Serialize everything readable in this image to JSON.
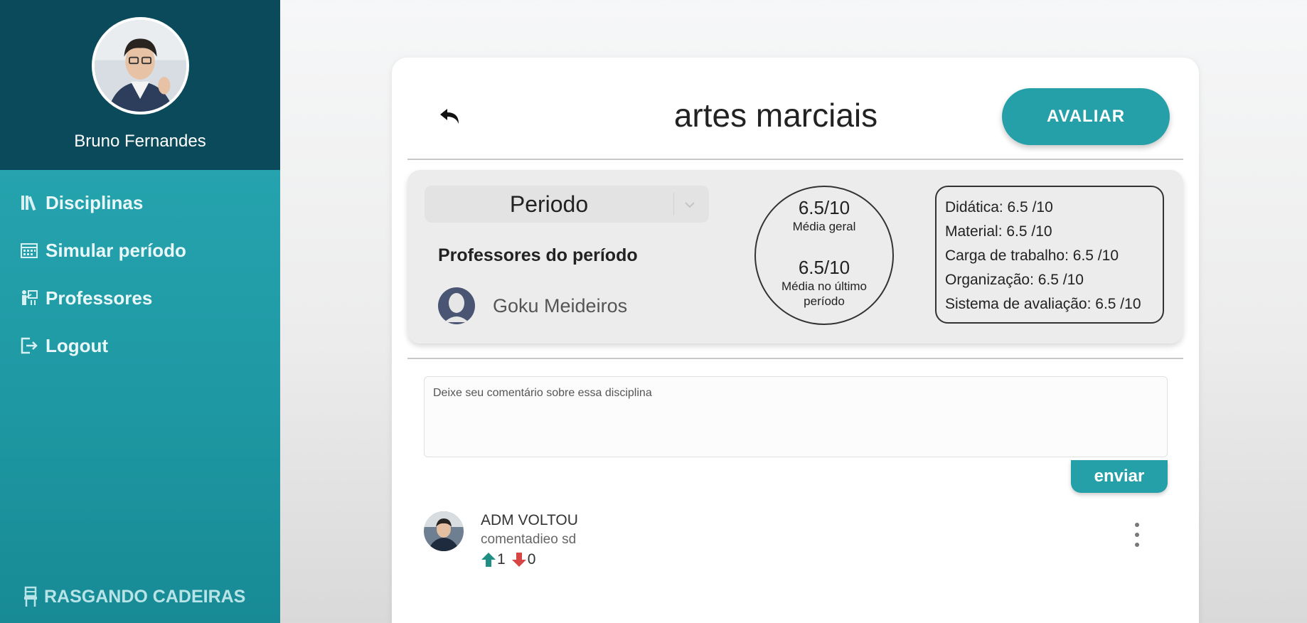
{
  "sidebar": {
    "user_name": "Bruno Fernandes",
    "items": [
      {
        "label": "Disciplinas",
        "icon": "books-icon"
      },
      {
        "label": "Simular período",
        "icon": "calendar-icon"
      },
      {
        "label": "Professores",
        "icon": "teacher-icon"
      },
      {
        "label": "Logout",
        "icon": "logout-icon"
      }
    ],
    "brand": "RASGANDO CADEIRAS",
    "colors": {
      "profile_bg": "#0b4a5b",
      "nav_bg": "#2aaab5"
    }
  },
  "header": {
    "title": "artes marciais",
    "avaliar_label": "AVALIAR"
  },
  "info": {
    "periodo_select": "Periodo",
    "professors_heading": "Professores do período",
    "professors": [
      "Goku Meideiros"
    ],
    "media_geral_value": "6.5/10",
    "media_geral_label": "Média geral",
    "media_ultimo_value": "6.5/10",
    "media_ultimo_label": "Média no último período",
    "ratings": [
      "Didática: 6.5 /10",
      "Material: 6.5 /10",
      "Carga de trabalho: 6.5 /10",
      "Organização: 6.5 /10",
      "Sistema de avaliação: 6.5 /10"
    ]
  },
  "comment_form": {
    "placeholder": "Deixe seu comentário sobre essa disciplina",
    "submit_label": "enviar"
  },
  "comments": [
    {
      "author": "ADM VOLTOU",
      "text": "comentadieo sd",
      "upvotes": "1",
      "downvotes": "0"
    }
  ],
  "accent_color": "#25a0a8"
}
